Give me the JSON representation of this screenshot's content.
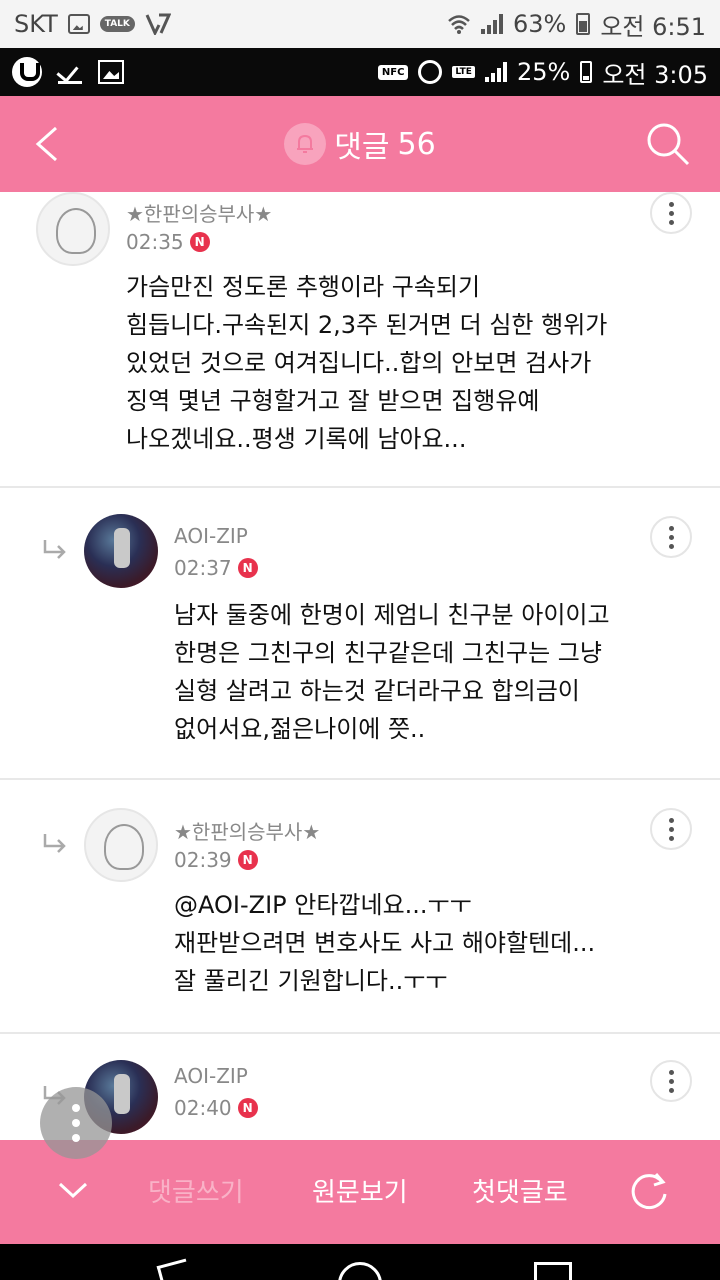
{
  "outer_status": {
    "carrier": "SKT",
    "talk_label": "TALK",
    "battery": "63%",
    "time": "오전 6:51"
  },
  "inner_status": {
    "nfc_label": "NFC",
    "lte_label": "LTE",
    "battery": "25%",
    "time": "오전 3:05"
  },
  "header": {
    "title": "댓글",
    "count": "56"
  },
  "comments": [
    {
      "author": "★한판의승부사★",
      "time": "02:35",
      "badge": "N",
      "text": "가슴만진 정도론 추행이라 구속되기\n힘듭니다.구속된지 2,3주 된거면 더 심한 행위가\n있었던 것으로 여겨집니다..합의 안보면 검사가\n징역 몇년 구형할거고 잘 받으면 집행유예\n나오겠네요..평생 기록에 남아요..."
    },
    {
      "author": "AOI-ZIP",
      "time": "02:37",
      "badge": "N",
      "text": "남자 둘중에 한명이 제엄니 친구분 아이이고\n한명은 그친구의 친구같은데 그친구는 그냥\n실형 살려고 하는것 같더라구요 합의금이\n없어서요,젊은나이에 쯧.."
    },
    {
      "author": "★한판의승부사★",
      "time": "02:39",
      "badge": "N",
      "text": "@AOI-ZIP 안타깝네요...ㅜㅜ\n재판받으려면 변호사도 사고 해야할텐데...\n잘 풀리긴 기원합니다..ㅜㅜ"
    },
    {
      "author": "AOI-ZIP",
      "time": "02:40",
      "badge": "N",
      "text": ""
    }
  ],
  "bottom_bar": {
    "write": "댓글쓰기",
    "original": "원문보기",
    "first": "첫댓글로"
  },
  "icons": {
    "back": "chevron-left-icon",
    "search": "search-icon",
    "bell": "bell-icon",
    "more": "more-vertical-icon",
    "reply": "reply-arrow-icon",
    "refresh": "refresh-icon",
    "chevron_down": "chevron-down-icon"
  },
  "colors": {
    "brand_pink": "#f47a9f",
    "badge_red": "#e8324d"
  }
}
